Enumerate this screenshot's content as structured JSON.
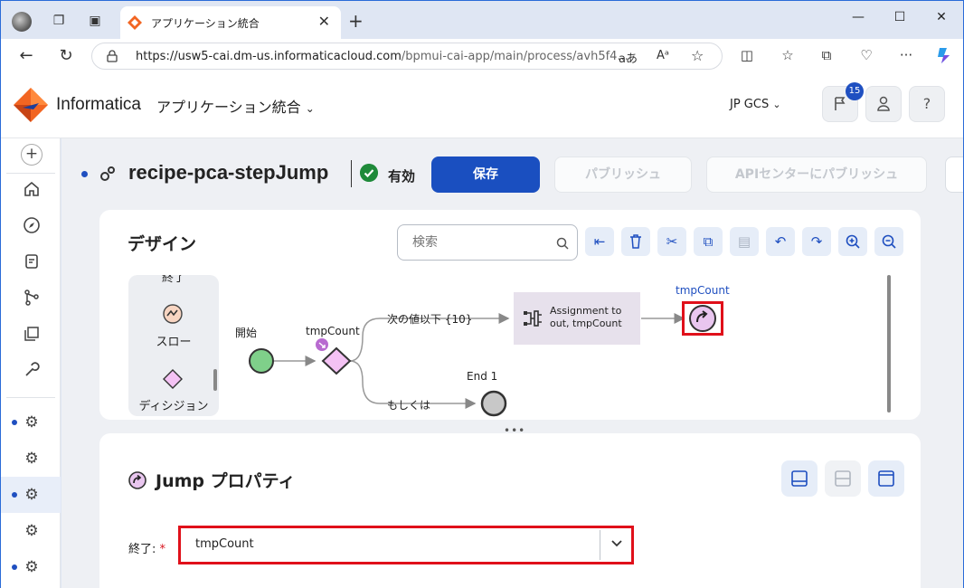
{
  "browser": {
    "tab_title": "アプリケーション統合",
    "url_main": "https://usw5-cai.dm-us.informaticacloud.com",
    "url_rest": "/bpmui-cai-app/main/process/avh5f4...",
    "url_icons": [
      "aあ",
      "Aᵃ"
    ]
  },
  "header": {
    "brand": "Informatica",
    "app_name": "アプリケーション統合",
    "org": "JP GCS",
    "notification_count": "15",
    "help": "?"
  },
  "page": {
    "title": "recipe-pca-stepJump",
    "status": "有効",
    "save": "保存",
    "publish": "パブリッシュ",
    "publish_api": "APIセンターにパブリッシュ"
  },
  "design": {
    "title": "デザイン",
    "search_placeholder": "検索",
    "palette": {
      "top_partial": "終了",
      "slow": "スロー",
      "decision": "ディシジョン"
    },
    "canvas": {
      "start": "開始",
      "decision_label": "tmpCount",
      "path_1": "次の値以下 {10}",
      "path_2": "もしくは",
      "end_label": "End 1",
      "assignment_line1": "Assignment to",
      "assignment_line2": "out, tmpCount",
      "jump_label": "tmpCount"
    }
  },
  "properties": {
    "title": "Jump プロパティ",
    "field_label": "終了:",
    "required_mark": "*",
    "field_value": "tmpCount"
  },
  "colors": {
    "primary": "#1a4fc0",
    "highlight": "#e0101a",
    "start_node": "#7fd08a",
    "decision_node": "#f4c2f4",
    "jump_node": "#e9c6ef"
  }
}
